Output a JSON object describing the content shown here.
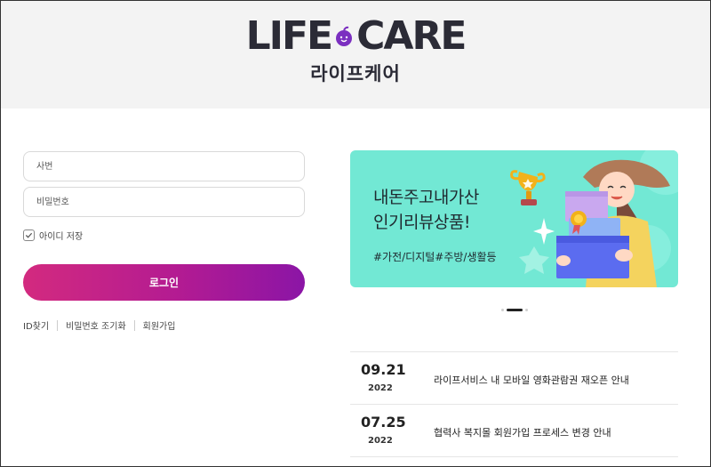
{
  "logo": {
    "en_left": "LIFE",
    "en_right": "CARE",
    "ko": "라이프케어"
  },
  "login": {
    "id_placeholder": "사번",
    "pw_placeholder": "비밀번호",
    "remember_label": "아이디 저장",
    "remember_checked": true,
    "button_label": "로그인",
    "links": [
      "ID찾기",
      "비밀번호 조기화",
      "회원가입"
    ]
  },
  "banner": {
    "line1": "내돈주고내가산",
    "line2": "인기리뷰상품!",
    "tags": "#가전/디지털#주방/생활등",
    "slide_count": 3,
    "active_slide": 2,
    "colors": {
      "background": "#72e8d4",
      "hat": "#b07a58",
      "shirt": "#f4d35e",
      "box_blue": "#5b6cf0",
      "box_purple": "#c9a8ef"
    }
  },
  "notices": [
    {
      "date": "09.21",
      "year": "2022",
      "title": "라이프서비스 내 모바일 영화관람권 재오픈 안내"
    },
    {
      "date": "07.25",
      "year": "2022",
      "title": "협력사 복지몰 회원가입 프로세스 변경 안내"
    }
  ],
  "colors": {
    "login_gradient_start": "#d32a7f",
    "login_gradient_end": "#8b15a6",
    "header_bg": "#f3f3f3"
  }
}
